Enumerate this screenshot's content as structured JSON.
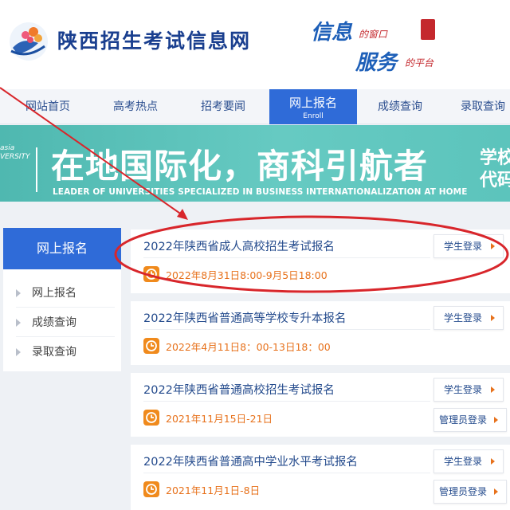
{
  "header": {
    "site_title": "陕西招生考试信息网",
    "slogan_line1": "信息",
    "slogan_line1_small": "的窗口",
    "slogan_line2": "服务",
    "slogan_line2_small": "的平台"
  },
  "nav": {
    "items": [
      {
        "label": "网站首页"
      },
      {
        "label": "高考热点"
      },
      {
        "label": "招考要闻"
      },
      {
        "label": "网上报名",
        "sub": "Enroll",
        "active": true
      },
      {
        "label": "成绩查询"
      },
      {
        "label": "录取查询"
      }
    ]
  },
  "banner": {
    "left_text_1": "asia",
    "left_text_2": "VERSITY",
    "title": "在地国际化，商科引航者",
    "subtitle": "LEADER OF UNIVERSITIES SPECIALIZED IN BUSINESS INTERNATIONALIZATION AT HOME",
    "right_text": "学校代码"
  },
  "sidebar": {
    "title": "网上报名",
    "items": [
      {
        "label": "网上报名"
      },
      {
        "label": "成绩查询"
      },
      {
        "label": "录取查询"
      }
    ]
  },
  "cards": [
    {
      "title": "2022年陕西省成人高校招生考试报名",
      "time": "2022年8月31日8:00-9月5日18:00",
      "buttons": [
        "学生登录"
      ]
    },
    {
      "title": "2022年陕西省普通高等学校专升本报名",
      "time": "2022年4月11日8：00-13日18：00",
      "buttons": [
        "学生登录"
      ]
    },
    {
      "title": "2022年陕西省普通高校招生考试报名",
      "time": "2021年11月15日-21日",
      "buttons": [
        "学生登录",
        "管理员登录"
      ]
    },
    {
      "title": "2022年陕西省普通高中学业水平考试报名",
      "time": "2021年11月1日-8日",
      "buttons": [
        "学生登录",
        "管理员登录"
      ]
    }
  ],
  "colors": {
    "nav_active": "#2f6bd8",
    "banner": "#5cc4bc",
    "time_text": "#e7711b",
    "title_text": "#234a8c",
    "annotation_red": "#d8262b"
  }
}
